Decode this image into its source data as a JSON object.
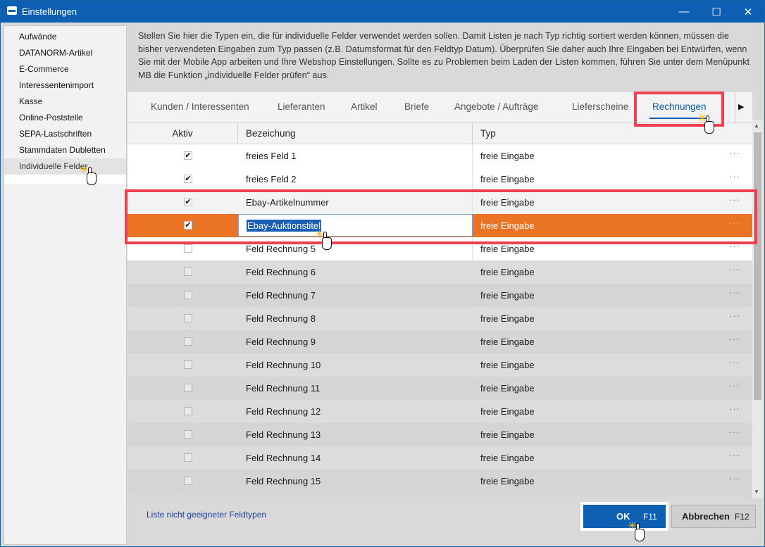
{
  "window": {
    "title": "Einstellungen",
    "minimize": "—",
    "maximize": "☐",
    "close": "✕"
  },
  "sidebar": {
    "items": [
      {
        "label": "Aufwände"
      },
      {
        "label": "DATANORM-Artikel"
      },
      {
        "label": "E-Commerce"
      },
      {
        "label": "Interessentenimport"
      },
      {
        "label": "Kasse"
      },
      {
        "label": "Online-Poststelle"
      },
      {
        "label": "SEPA-Lastschriften"
      },
      {
        "label": "Stammdaten Dubletten"
      },
      {
        "label": "Individuelle Felder"
      }
    ],
    "selected": "Individuelle Felder"
  },
  "info_text": "Stellen Sie hier die Typen ein, die für individuelle Felder verwendet werden sollen. Damit Listen je nach Typ richtig sortiert werden können, müssen die bisher verwendeten Eingaben zum Typ passen (z.B. Datumsformat für den Feldtyp Datum). Überprüfen Sie daher auch Ihre Eingaben bei Entwürfen, wenn Sie mit der Mobile App arbeiten und Ihre Webshop Einstellungen. Sollte es zu Problemen beim Laden der Listen kommen, führen Sie unter dem Menüpunkt MB die Funktion „individuelle Felder prüfen“ aus.",
  "tabs": [
    {
      "label": "Kunden / Interessenten"
    },
    {
      "label": "Lieferanten"
    },
    {
      "label": "Artikel"
    },
    {
      "label": "Briefe"
    },
    {
      "label": "Angebote / Aufträge"
    },
    {
      "label": "Lieferscheine"
    },
    {
      "label": "Rechnungen"
    }
  ],
  "active_tab": "Rechnungen",
  "tab_scroll_icon": "triangle-right",
  "grid": {
    "headers": {
      "active": "Aktiv",
      "name": "Bezeichung",
      "type": "Typ"
    },
    "rows": [
      {
        "checked": "✔",
        "name": "freies Feld 1",
        "type": "freie Eingabe",
        "more": "···"
      },
      {
        "checked": "✔",
        "name": "freies Feld 2",
        "type": "freie Eingabe",
        "more": "···"
      },
      {
        "checked": "✔",
        "name": "Ebay-Artikelnummer",
        "type": "freie Eingabe",
        "more": "···"
      },
      {
        "checked": "✔",
        "name": "Ebay-Auktionstitel",
        "type": "freie Eingabe",
        "more": "···"
      },
      {
        "checked": "",
        "name": "Feld Rechnung 5",
        "type": "freie Eingabe",
        "more": "···"
      },
      {
        "checked": "",
        "name": "Feld Rechnung 6",
        "type": "freie Eingabe",
        "more": "···"
      },
      {
        "checked": "",
        "name": "Feld Rechnung 7",
        "type": "freie Eingabe",
        "more": "···"
      },
      {
        "checked": "",
        "name": "Feld Rechnung 8",
        "type": "freie Eingabe",
        "more": "···"
      },
      {
        "checked": "",
        "name": "Feld Rechnung 9",
        "type": "freie Eingabe",
        "more": "···"
      },
      {
        "checked": "",
        "name": "Feld Rechnung 10",
        "type": "freie Eingabe",
        "more": "···"
      },
      {
        "checked": "",
        "name": "Feld Rechnung 11",
        "type": "freie Eingabe",
        "more": "···"
      },
      {
        "checked": "",
        "name": "Feld Rechnung 12",
        "type": "freie Eingabe",
        "more": "···"
      },
      {
        "checked": "",
        "name": "Feld Rechnung 13",
        "type": "freie Eingabe",
        "more": "···"
      },
      {
        "checked": "",
        "name": "Feld Rechnung 14",
        "type": "freie Eingabe",
        "more": "···"
      },
      {
        "checked": "",
        "name": "Feld Rechnung 15",
        "type": "freie Eingabe",
        "more": "···"
      }
    ],
    "editing_value": "Ebay-Auktionstitel"
  },
  "footer": {
    "link": "Liste nicht geeigneter Feldtypen",
    "ok_label": "OK",
    "ok_key": "F11",
    "cancel_label": "Abbrechen",
    "cancel_key": "F12"
  },
  "colors": {
    "accent": "#0d5fb3",
    "selected_row": "#ea7424",
    "highlight_box": "#ef4050"
  }
}
